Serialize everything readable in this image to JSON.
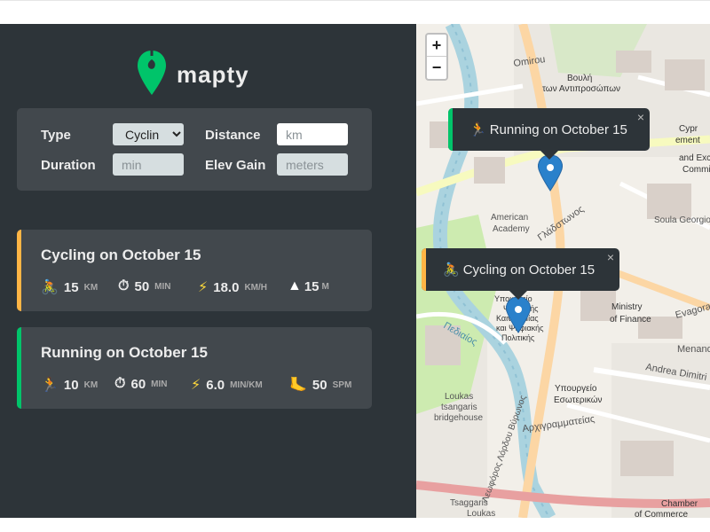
{
  "app": {
    "name": "mapty"
  },
  "form": {
    "type_label": "Type",
    "type_value": "Cyclin",
    "distance_label": "Distance",
    "distance_placeholder": "km",
    "duration_label": "Duration",
    "duration_placeholder": "min",
    "elev_label": "Elev Gain",
    "elev_placeholder": "meters"
  },
  "workouts": [
    {
      "title": "Cycling on October 15",
      "color": "#ffb545",
      "type": "cycling",
      "icon": "cyclist-icon",
      "distance": "15",
      "distance_unit": "KM",
      "duration": "50",
      "duration_unit": "MIN",
      "speed": "18.0",
      "speed_unit": "KM/H",
      "elev": "15",
      "elev_unit": "M"
    },
    {
      "title": "Running on October 15",
      "color": "#00c46a",
      "type": "running",
      "icon": "runner-icon",
      "distance": "10",
      "distance_unit": "KM",
      "duration": "60",
      "duration_unit": "MIN",
      "pace": "6.0",
      "pace_unit": "MIN/KM",
      "cadence": "50",
      "cadence_unit": "SPM"
    }
  ],
  "map": {
    "zoom_in": "+",
    "zoom_out": "−",
    "popups": [
      {
        "text": "Running on October 15",
        "color": "#00c46a",
        "close": "×"
      },
      {
        "text": "Cycling on October 15",
        "color": "#ffb545",
        "close": "×"
      }
    ],
    "labels": {
      "omirou": "Omirou",
      "vouli1": "Βουλή",
      "vouli2": "των Αντιπροσώπων",
      "american1": "American",
      "american2": "Academy",
      "gladstonos": "Γλάδστωνος",
      "soula": "Soula Georgio",
      "ministry1": "Ministry",
      "ministry2": "of Finance",
      "evagoras": "Evagoras",
      "menandr": "Menandr",
      "andrea": "Andrea Dimitri",
      "ypourgeio1": "Υπουργείο",
      "ypourgeio2": "Εσωτερικών",
      "pedieos": "Πεδιαίος",
      "arch": "Αρχιγραμματείας",
      "loukas1": "Loukas",
      "loukas2": "tsangaris",
      "loukas3": "bridgehouse",
      "leof": "Λεωφόρος Λόρδου Βύρωνος",
      "tsaggaris1": "Tsaggaris",
      "tsaggaris2": "Loukas",
      "chamber1": "Chamber",
      "chamber2": "of Commerce",
      "cypr1": "Cypr",
      "cypr2": "ement",
      "cypr3": "and Excl",
      "cypr4": "Commi",
      "politikis1": "Υπουργείο",
      "politikis2": "Ψηφιακής",
      "politikis3": "Καινοτομίας",
      "politikis4": "και Ψηφιακής",
      "politikis5": "Πολιτικής"
    }
  }
}
